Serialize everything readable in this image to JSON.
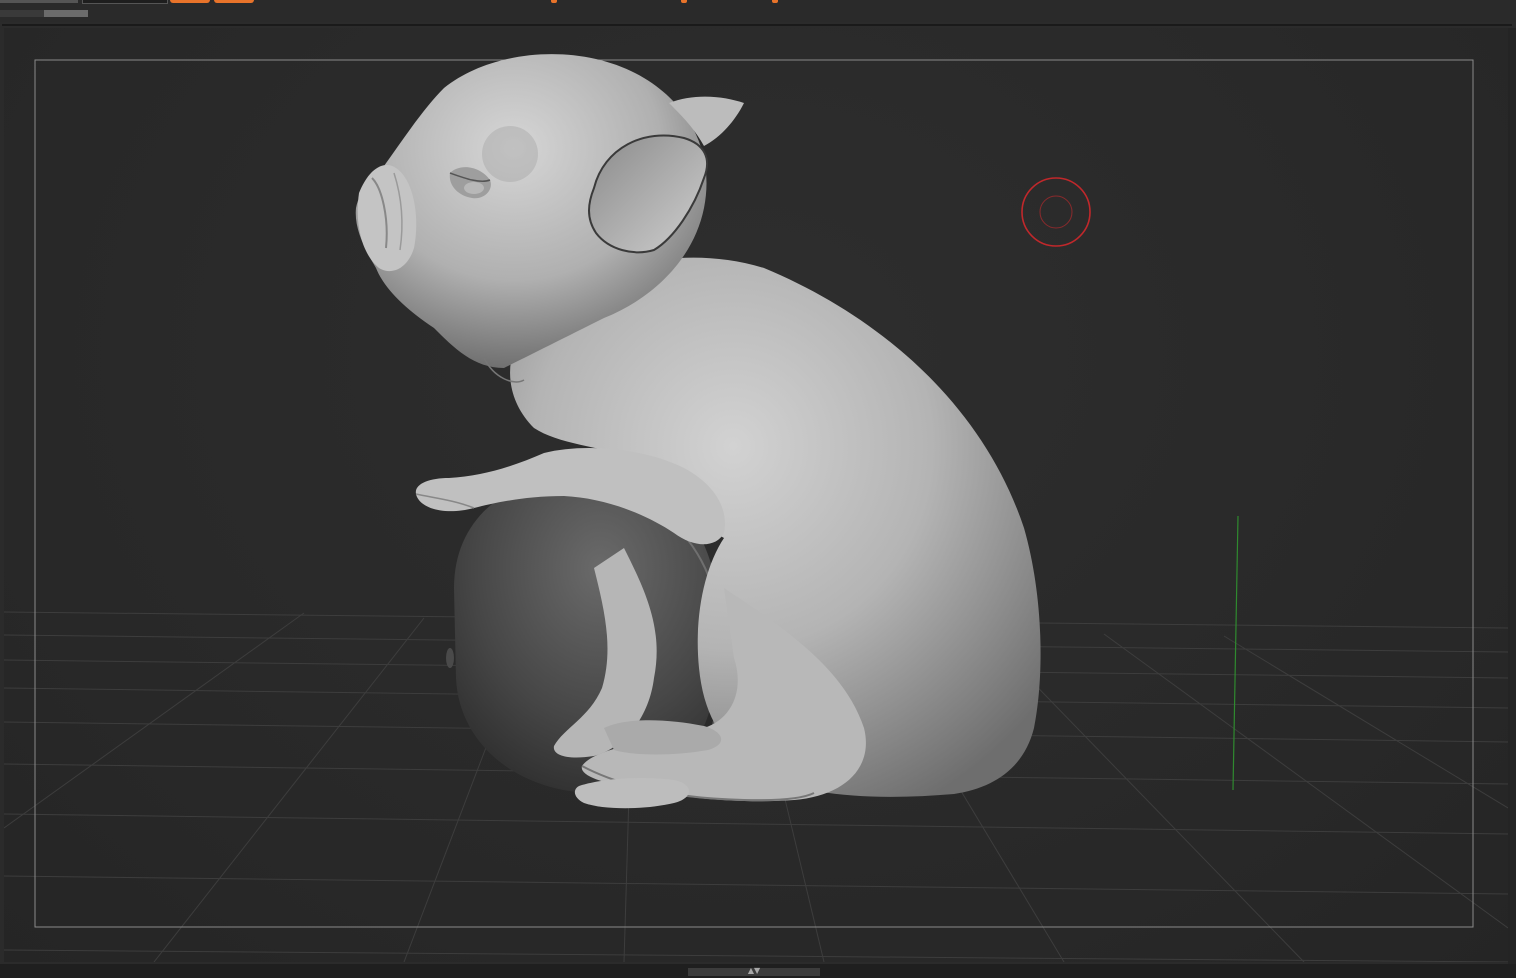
{
  "app": {
    "accent_color": "#e8732a",
    "background_color": "#2b2b2b"
  },
  "toolbar": {
    "tabs": [
      {
        "icon": "tab-active"
      },
      {
        "icon": "tab-inactive"
      }
    ],
    "buttons": [
      {
        "icon": "orange-toggle"
      },
      {
        "icon": "orange-toggle"
      }
    ],
    "markers": [
      {
        "icon": "orange-marker"
      },
      {
        "icon": "orange-marker"
      },
      {
        "icon": "orange-marker"
      }
    ]
  },
  "progress": {
    "fraction": 0.5
  },
  "viewport": {
    "model": "pig sculpt",
    "brush_cursor_color": "#c0282b",
    "axis_y_color": "#2f8a2f",
    "grid": true
  },
  "bottom": {
    "toggle_icon": "up-down-arrows-icon",
    "arrows_glyph": "▲▼"
  }
}
